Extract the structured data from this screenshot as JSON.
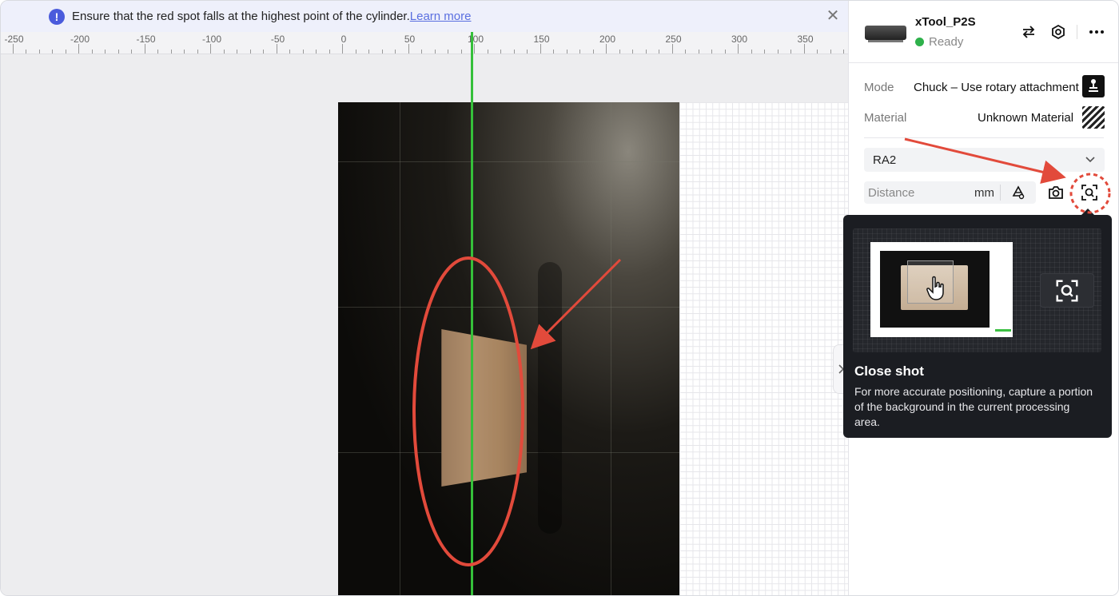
{
  "notice": {
    "message": "Ensure that the red spot falls at the highest point of the cylinder.",
    "link": "Learn more"
  },
  "ruler": {
    "labels": [
      "-250",
      "-200",
      "-150",
      "-100",
      "-50",
      "0",
      "50",
      "100",
      "150",
      "200",
      "250",
      "300",
      "350"
    ]
  },
  "device": {
    "name": "xTool_P2S",
    "status": "Ready",
    "status_color": "#2eb14b"
  },
  "settings": {
    "mode_label": "Mode",
    "mode_value": "Chuck – Use rotary attachment",
    "material_label": "Material",
    "material_value": "Unknown Material",
    "selected_attachment": "RA2",
    "distance_placeholder": "Distance",
    "distance_unit": "mm"
  },
  "tooltip": {
    "title": "Close shot",
    "body": "For more accurate positioning, capture a portion of the background in the current processing area."
  },
  "icons": {
    "notice": "info-icon",
    "close": "close-icon",
    "switch": "swap-arrows-icon",
    "device_settings": "target-icon",
    "more": "more-icon",
    "mode": "rotary-mode-icon",
    "material": "material-hatch-icon",
    "dropdown": "chevron-down-icon",
    "auto_measure": "auto-measure-icon",
    "camera": "camera-icon",
    "close_shot": "close-shot-icon",
    "expand": "chevron-right-icon"
  },
  "colors": {
    "accent": "#4a5bdc",
    "guide_line": "#35c03a",
    "annotation": "#e24a3b"
  }
}
